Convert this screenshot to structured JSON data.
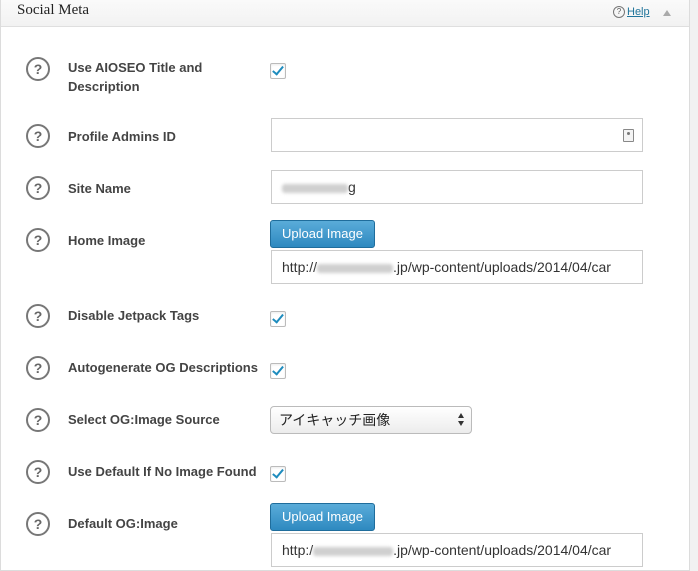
{
  "panel": {
    "title": "Social Meta",
    "help_label": "Help"
  },
  "fields": {
    "use_aioseo_title": {
      "label_line1": "Use AIOSEO Title and",
      "label_line2": "Description",
      "checked": true
    },
    "profile_admins_id": {
      "label": "Profile Admins ID",
      "value": ""
    },
    "site_name": {
      "label": "Site Name",
      "value_suffix": "g"
    },
    "home_image": {
      "label": "Home Image",
      "button": "Upload Image",
      "url_prefix": "http://",
      "url_suffix": ".jp/wp-content/uploads/2014/04/car"
    },
    "disable_jetpack": {
      "label": "Disable Jetpack Tags",
      "checked": true
    },
    "autogenerate_og": {
      "label": "Autogenerate OG Descriptions",
      "checked": true
    },
    "og_image_source": {
      "label": "Select OG:Image Source",
      "selected": "アイキャッチ画像"
    },
    "use_default_image": {
      "label": "Use Default If No Image Found",
      "checked": true
    },
    "default_og_image": {
      "label": "Default OG:Image",
      "button": "Upload Image",
      "url_prefix": "http:/",
      "url_suffix": ".jp/wp-content/uploads/2014/04/car"
    }
  },
  "icons": {
    "help_circle": "question-mark-circle",
    "checkbox_check": "checkmark",
    "field_icon": "contact-card",
    "collapse": "triangle-up"
  },
  "colors": {
    "accent": "#2e89c0",
    "link": "#21759b",
    "check": "#1e8cbe"
  }
}
